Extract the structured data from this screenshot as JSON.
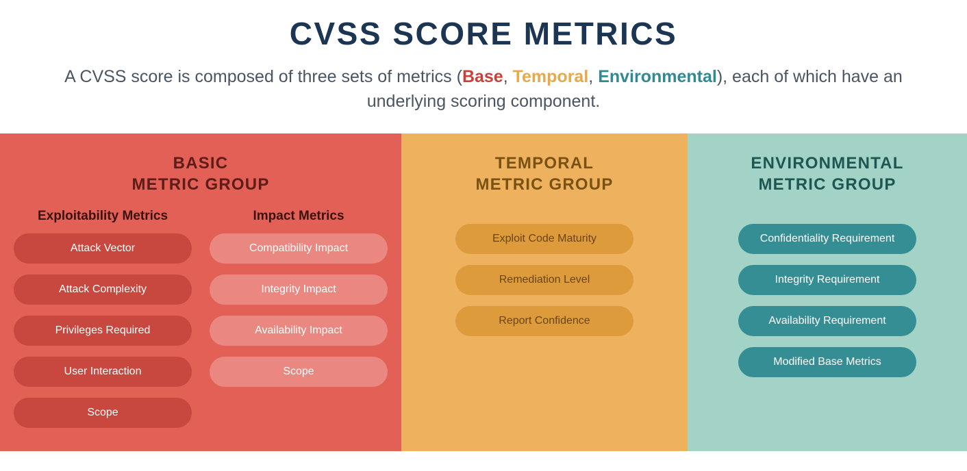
{
  "title": "CVSS SCORE METRICS",
  "subtitle": {
    "prefix": "A CVSS score is composed of three sets of metrics (",
    "base": "Base",
    "comma1": ", ",
    "temporal": "Temporal",
    "comma2": ", ",
    "environmental": "Environmental",
    "suffix": "), each of which have an underlying scoring component."
  },
  "groups": {
    "basic": {
      "title_line1": "BASIC",
      "title_line2": "METRIC GROUP",
      "exploitability": {
        "heading": "Exploitability Metrics",
        "items": [
          "Attack Vector",
          "Attack Complexity",
          "Privileges Required",
          "User Interaction",
          "Scope"
        ]
      },
      "impact": {
        "heading": "Impact Metrics",
        "items": [
          "Compatibility Impact",
          "Integrity Impact",
          "Availability Impact",
          "Scope"
        ]
      }
    },
    "temporal": {
      "title_line1": "TEMPORAL",
      "title_line2": "METRIC GROUP",
      "items": [
        "Exploit Code Maturity",
        "Remediation Level",
        "Report Confidence"
      ]
    },
    "environmental": {
      "title_line1": "ENVIRONMENTAL",
      "title_line2": "METRIC GROUP",
      "items": [
        "Confidentiality Requirement",
        "Integrity Requirement",
        "Availability Requirement",
        "Modified Base Metrics"
      ]
    }
  }
}
